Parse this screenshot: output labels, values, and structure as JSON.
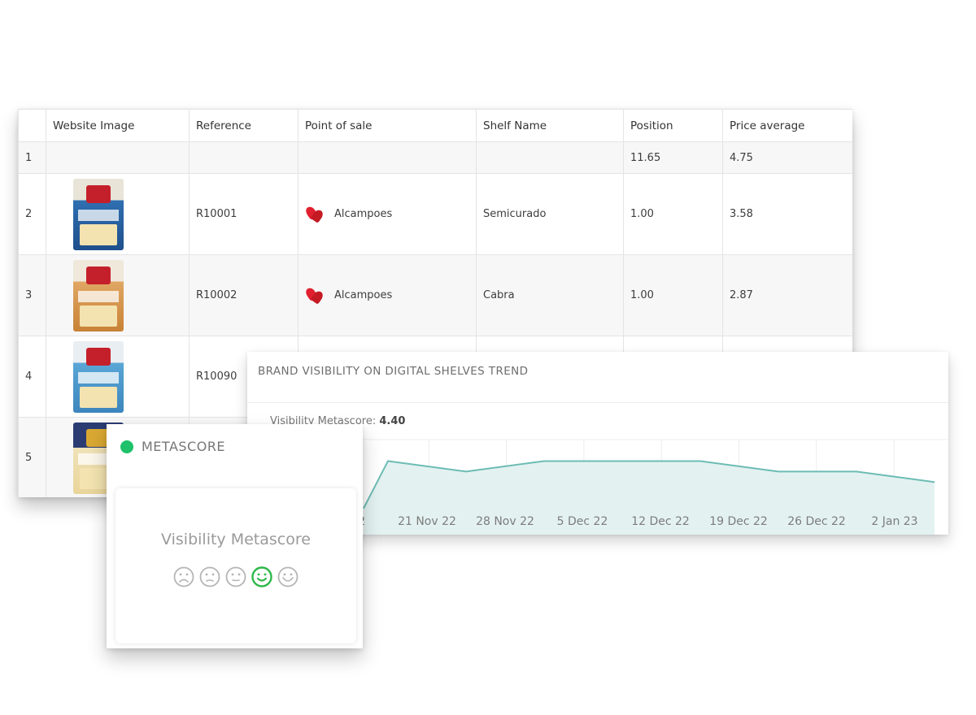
{
  "table": {
    "columns": [
      "Website Image",
      "Reference",
      "Point of sale",
      "Shelf Name",
      "Position",
      "Price average"
    ],
    "summary_row": {
      "num": "1",
      "position": "11.65",
      "price": "4.75"
    },
    "rows": [
      {
        "num": "2",
        "image": "product-thumbnail-semicurado",
        "reference": "R10001",
        "store": "Alcampoes",
        "store_icon": "alcampo-bird-icon",
        "shelf": "Semicurado",
        "position": "1.00",
        "price": "3.58"
      },
      {
        "num": "3",
        "image": "product-thumbnail-cabra",
        "reference": "R10002",
        "store": "Alcampoes",
        "store_icon": "alcampo-bird-icon",
        "shelf": "Cabra",
        "position": "1.00",
        "price": "2.87"
      },
      {
        "num": "4",
        "image": "product-thumbnail-tierno",
        "reference": "R10090",
        "store": "",
        "shelf": "",
        "position": "",
        "price": ""
      },
      {
        "num": "5",
        "image": "product-thumbnail-gran-capitan",
        "reference": "",
        "store": "",
        "shelf": "",
        "position": "",
        "price": ""
      }
    ]
  },
  "trend": {
    "title": "BRAND VISIBILITY ON DIGITAL SHELVES TREND",
    "metascore_label": "Visibility Metascore:",
    "metascore_value": "4.40",
    "line_color": "#6cbcb4",
    "fill_color": "#e3f2f1"
  },
  "chart_data": {
    "type": "area",
    "x": [
      "14 Nov 22",
      "21 Nov 22",
      "28 Nov 22",
      "5 Dec 22",
      "12 Dec 22",
      "19 Dec 22",
      "26 Dec 22",
      "2 Jan 23"
    ],
    "x_tick_labels": [
      "22",
      "21 Nov 22",
      "28 Nov 22",
      "5 Dec 22",
      "12 Dec 22",
      "19 Dec 22",
      "26 Dec 22",
      "2 Jan 23"
    ],
    "series": [
      {
        "values": [
          3.9,
          4.8,
          4.6,
          4.8,
          4.8,
          4.8,
          4.6,
          4.6,
          4.4
        ]
      }
    ],
    "grid": true
  },
  "metascore_card": {
    "title": "METASCORE",
    "dot_color": "#1fc16b",
    "label": "Visibility Metascore",
    "faces": [
      "very-sad-face-icon",
      "sad-face-icon",
      "neutral-face-icon",
      "happy-face-icon",
      "very-happy-face-icon"
    ],
    "selected_face_index": 3,
    "selected_color": "#2fb84a"
  }
}
